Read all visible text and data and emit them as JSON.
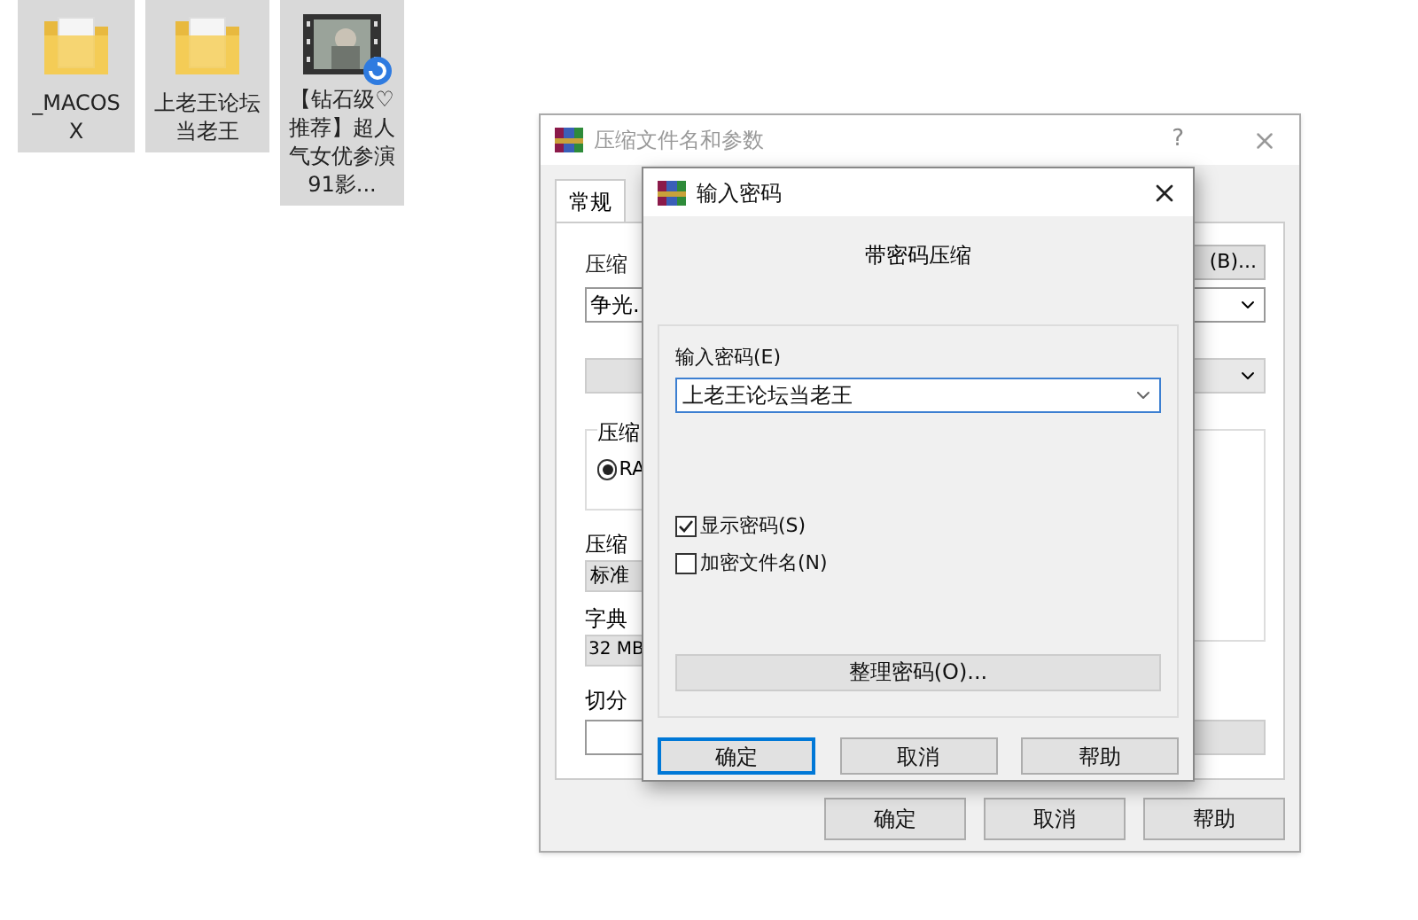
{
  "desktop_icons": [
    {
      "kind": "folder",
      "label": "_MACOSX",
      "selected": true
    },
    {
      "kind": "folder",
      "label": "上老王论坛当老王",
      "selected": true
    },
    {
      "kind": "video",
      "label": "【钻石级♡推荐】超人气女优参演91影...",
      "selected": true
    }
  ],
  "archive_dialog": {
    "title": "压缩文件名和参数",
    "help": "?",
    "tabs": [
      {
        "label": "常规",
        "selected": true
      }
    ],
    "labels": {
      "archive_name": "压缩",
      "archive_name_value": "争光.",
      "browse": "(B)...",
      "format_group": "压缩",
      "format_option": "RA",
      "method": "压缩",
      "method_value": "标准",
      "dict": "字典",
      "dict_value": "32 MB",
      "split": "切分"
    },
    "format_selected": true,
    "buttons": [
      "确定",
      "取消",
      "帮助"
    ]
  },
  "password_dialog": {
    "title": "输入密码",
    "heading": "带密码压缩",
    "password_label": "输入密码(E)",
    "password_value": "上老王论坛当老王",
    "options": [
      {
        "label": "显示密码(S)",
        "checked": true
      },
      {
        "label": "加密文件名(N)",
        "checked": false
      }
    ],
    "organize_button": "整理密码(O)...",
    "buttons": [
      {
        "label": "确定",
        "selected": true
      },
      {
        "label": "取消",
        "selected": false
      },
      {
        "label": "帮助",
        "selected": false
      }
    ]
  }
}
